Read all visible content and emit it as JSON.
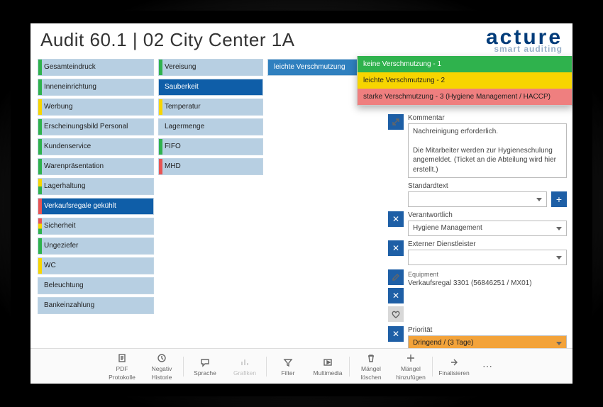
{
  "header": {
    "title": "Audit 60.1 | 02 City Center 1A",
    "brand_line1": "acture",
    "brand_line2": "smart auditing"
  },
  "col1": [
    {
      "label": "Gesamteindruck",
      "color": "green"
    },
    {
      "label": "Inneneinrichtung",
      "color": "green"
    },
    {
      "label": "Werbung",
      "color": "yellow"
    },
    {
      "label": "Erscheinungsbild Personal",
      "color": "green"
    },
    {
      "label": "Kundenservice",
      "color": "green"
    },
    {
      "label": "Warenpräsentation",
      "color": "green"
    },
    {
      "label": "Lagerhaltung",
      "color": "yellowgreen"
    },
    {
      "label": "Verkaufsregale gekühlt",
      "color": "red",
      "active": true
    },
    {
      "label": "Sicherheit",
      "color": "multi"
    },
    {
      "label": "Ungeziefer",
      "color": "green"
    },
    {
      "label": "WC",
      "color": "yellow"
    },
    {
      "label": "Beleuchtung",
      "color": ""
    },
    {
      "label": "Bankeinzahlung",
      "color": ""
    }
  ],
  "col2": [
    {
      "label": "Vereisung",
      "color": "green"
    },
    {
      "label": "Sauberkeit",
      "color": "",
      "active": true
    },
    {
      "label": "Temperatur",
      "color": "yellow"
    },
    {
      "label": "Lagermenge",
      "color": ""
    },
    {
      "label": "FIFO",
      "color": "green"
    },
    {
      "label": "MHD",
      "color": "red"
    }
  ],
  "col3": [
    {
      "label": "leichte Verschmutzung",
      "color": "",
      "active": true
    }
  ],
  "ratings": [
    {
      "text": "keine Verschmutzung - 1",
      "cls": "o1"
    },
    {
      "text": "leichte Verschmutzung - 2",
      "cls": "o2"
    },
    {
      "text": "starke Verschmutzung - 3  (Hygiene Management / HACCP)",
      "cls": "o3"
    }
  ],
  "panel": {
    "kommentar_label": "Kommentar",
    "kommentar_value": "Nachreinigung erforderlich.\n\nDie Mitarbeiter werden zur Hygieneschulung angemeldet. (Ticket an die Abteilung wird hier erstellt.)",
    "standardtext_label": "Standardtext",
    "standardtext_value": "",
    "verantwortlich_label": "Verantwortlich",
    "verantwortlich_value": "Hygiene Management",
    "extern_label": "Externer Dienstleister",
    "extern_value": "",
    "equipment_label": "Equipment",
    "equipment_value": "Verkaufsregal 3301 (56846251 / MX01)",
    "prioritaet_label": "Priorität",
    "prioritaet_value": "Dringend / (3 Tage)"
  },
  "toolbar": [
    {
      "icon": "pdf",
      "l1": "PDF",
      "l2": "Protokolle"
    },
    {
      "icon": "history",
      "l1": "Negativ",
      "l2": "Historie"
    },
    {
      "sep": true
    },
    {
      "icon": "speech",
      "l1": "Sprache",
      "l2": ""
    },
    {
      "icon": "chart",
      "l1": "Grafiken",
      "l2": "",
      "disabled": true
    },
    {
      "sep": true
    },
    {
      "icon": "filter",
      "l1": "Filter",
      "l2": ""
    },
    {
      "icon": "media",
      "l1": "Multimedia",
      "l2": ""
    },
    {
      "sep": true
    },
    {
      "icon": "trash",
      "l1": "Mängel",
      "l2": "löschen"
    },
    {
      "icon": "plus",
      "l1": "Mängel",
      "l2": "hinzufügen"
    },
    {
      "sep": true
    },
    {
      "icon": "arrow",
      "l1": "Finalisieren",
      "l2": ""
    }
  ]
}
